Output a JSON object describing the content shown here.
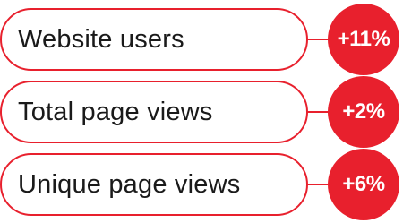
{
  "colors": {
    "accent": "#e8202d",
    "text": "#1a1a1a",
    "badge_text": "#ffffff",
    "background": "#ffffff"
  },
  "metrics": [
    {
      "label": "Website users",
      "change": "+11%"
    },
    {
      "label": "Total page views",
      "change": "+2%"
    },
    {
      "label": "Unique page views",
      "change": "+6%"
    }
  ]
}
